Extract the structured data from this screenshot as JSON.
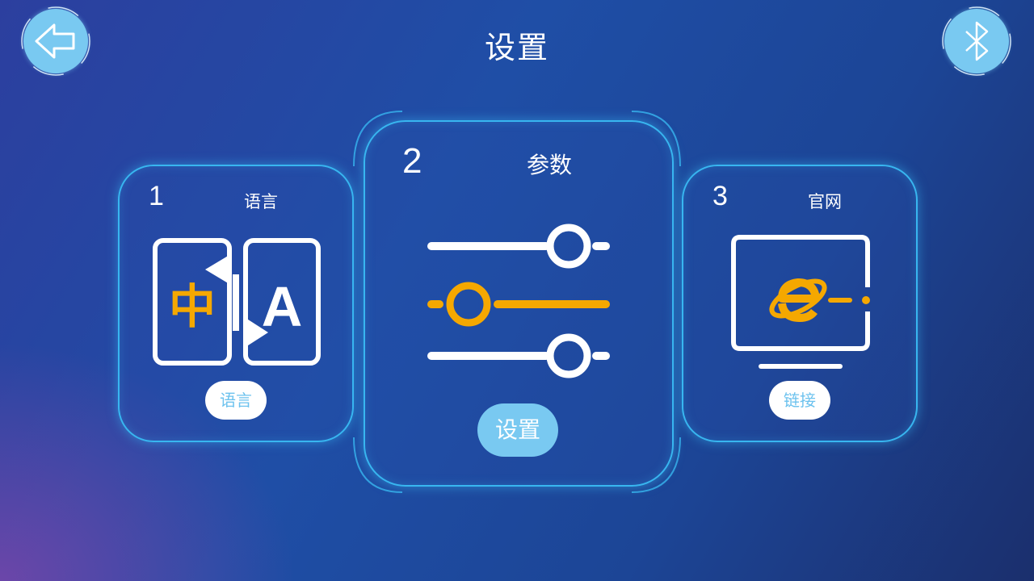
{
  "header": {
    "title": "设置",
    "back_icon": "arrow-left-icon",
    "bluetooth_icon": "bluetooth-icon"
  },
  "cards": [
    {
      "number": "1",
      "label": "语言",
      "button": "语言",
      "icon": "translate-icon"
    },
    {
      "number": "2",
      "label": "参数",
      "button": "设置",
      "icon": "sliders-icon"
    },
    {
      "number": "3",
      "label": "官网",
      "button": "链接",
      "icon": "browser-ie-icon"
    }
  ],
  "icon_text": {
    "chinese_char": "中",
    "latin_char": "A"
  },
  "colors": {
    "accent_blue": "#79c9f1",
    "card_border": "#38b6f0",
    "highlight_orange": "#f5a800",
    "text": "#ffffff"
  }
}
